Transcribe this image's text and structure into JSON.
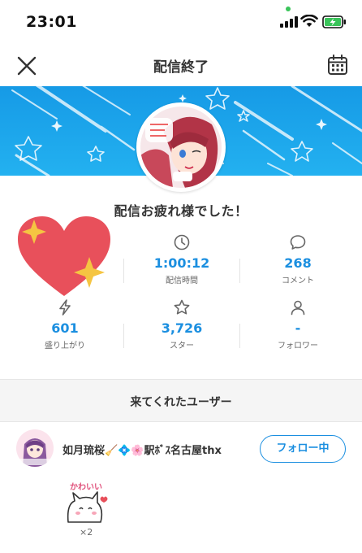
{
  "status_bar": {
    "time": "23:01"
  },
  "nav": {
    "title": "配信終了",
    "close_icon": "close-icon",
    "calendar_icon": "calendar-icon"
  },
  "banner": {
    "color": "#1aa3ea"
  },
  "message": "配信お疲れ様でした！",
  "stats": [
    {
      "icon": "clock-icon",
      "value": "1:00:12",
      "label": "配信時間"
    },
    {
      "icon": "comment-icon",
      "value": "268",
      "label": "コメント"
    },
    {
      "icon": "lightning-icon",
      "value": "601",
      "label": "盛り上がり"
    },
    {
      "icon": "star-icon",
      "value": "3,726",
      "label": "スター"
    },
    {
      "icon": "person-icon",
      "value": "-",
      "label": "フォロワー"
    }
  ],
  "section": {
    "title": "来てくれたユーザー"
  },
  "users": [
    {
      "name": "如月琉桜🧹💠🌸駅ﾎﾞｽ名古屋thx",
      "follow_label": "フォロー中",
      "gift": {
        "sticker_text": "かわいい",
        "count": "×2"
      }
    }
  ],
  "colors": {
    "accent": "#1b8fe0",
    "heart": "#e8505b",
    "sparkle": "#f5c542"
  }
}
